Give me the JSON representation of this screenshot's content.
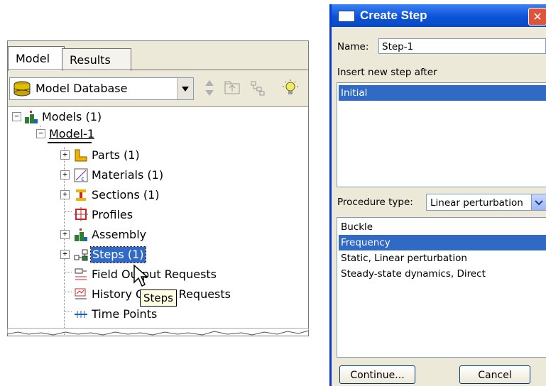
{
  "tabs": {
    "model": "Model",
    "results": "Results"
  },
  "database_select": {
    "value": "Model Database"
  },
  "tree": {
    "models": "Models (1)",
    "model1": "Model-1",
    "parts": "Parts (1)",
    "materials": "Materials (1)",
    "sections": "Sections (1)",
    "profiles": "Profiles",
    "assembly": "Assembly",
    "steps": "Steps (1)",
    "field_output": "Field Output Requests",
    "history_output": "History Output Requests",
    "time_points": "Time Points"
  },
  "tooltip": "Steps",
  "dialog": {
    "title": "Create Step",
    "close_icon": "close-icon",
    "name_label": "Name:",
    "name_value": "Step-1",
    "insert_label": "Insert new step after",
    "insert_list": [
      "Initial"
    ],
    "procedure_label": "Procedure type:",
    "procedure_value": "Linear perturbation",
    "procedures": [
      "Buckle",
      "Frequency",
      "Static, Linear perturbation",
      "Steady-state dynamics, Direct"
    ],
    "selected_procedure": "Frequency",
    "continue_label": "Continue...",
    "cancel_label": "Cancel"
  },
  "colors": {
    "selection": "#316ac5",
    "titlebar": "#0b53d8",
    "panel": "#ece9d8"
  }
}
